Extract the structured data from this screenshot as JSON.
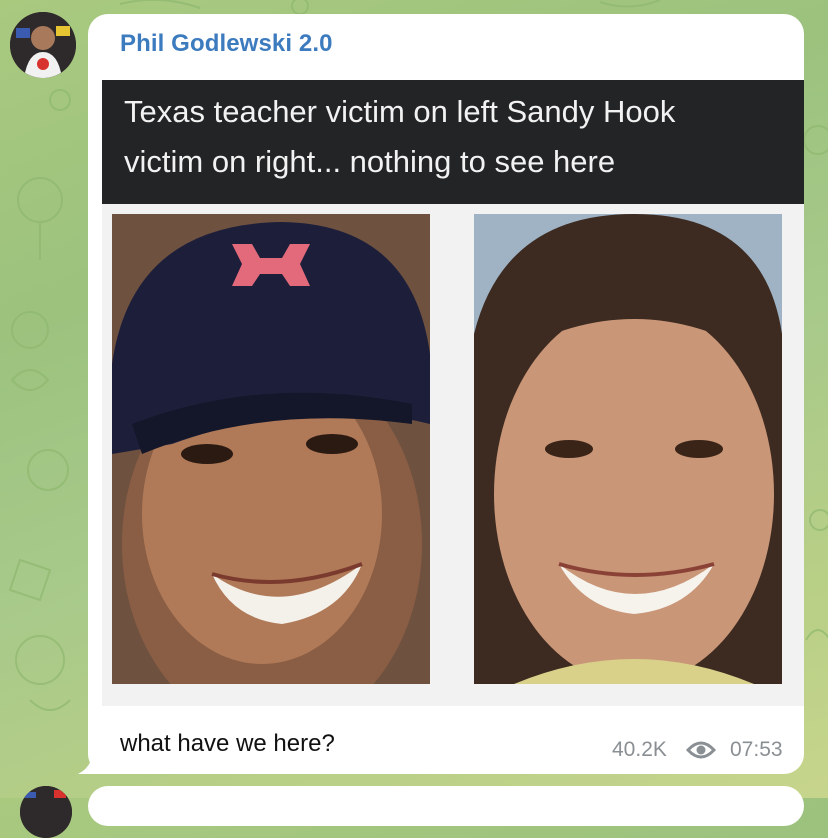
{
  "chat": {
    "sender_name": "Phil Godlewski 2.0",
    "message_text": "what have we here?",
    "views": "40.2K",
    "time": "07:53"
  },
  "image": {
    "caption_line_1": "Texas teacher victim on left Sandy Hook",
    "caption_line_2": "victim on right... nothing to see here"
  },
  "icons": {
    "views": "eye-icon"
  },
  "colors": {
    "sender_name": "#3d7bbf",
    "bubble": "#ffffff",
    "background": "#a9c97f",
    "caption_bar": "#222426",
    "meta_text": "#8a8f94"
  }
}
